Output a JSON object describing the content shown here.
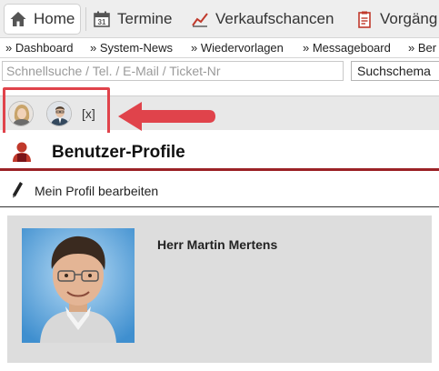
{
  "nav": {
    "items": [
      {
        "label": "Home",
        "icon": "home-icon"
      },
      {
        "label": "Termine",
        "icon": "calendar-icon"
      },
      {
        "label": "Verkaufschancen",
        "icon": "chart-icon"
      },
      {
        "label": "Vorgäng",
        "icon": "clipboard-icon"
      }
    ]
  },
  "quicklinks": [
    "» Dashboard",
    "» System-News",
    "» Wiedervorlagen",
    "» Messageboard",
    "» Ber"
  ],
  "search": {
    "placeholder": "Schnellsuche / Tel. / E-Mail / Ticket-Nr",
    "schema_label": "Suchschema"
  },
  "avatars": {
    "items": [
      "female-avatar-icon",
      "male-avatar-icon"
    ],
    "close_label": "[x]"
  },
  "section": {
    "title": "Benutzer-Profile",
    "icon": "user-profile-icon"
  },
  "edit": {
    "label": "Mein Profil bearbeiten",
    "icon": "pencil-icon"
  },
  "profile": {
    "name": "Herr Martin Mertens"
  },
  "colors": {
    "accent": "#9b2226",
    "highlight": "#e0434b",
    "card_bg": "#dddddd"
  }
}
